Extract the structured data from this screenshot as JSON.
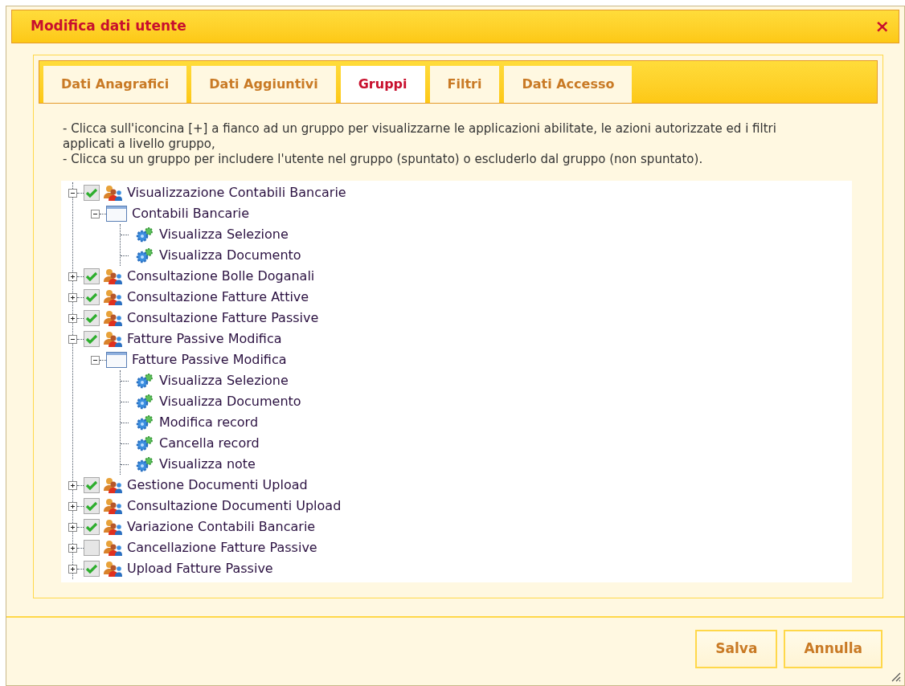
{
  "dialog": {
    "title": "Modifica dati utente",
    "close": "×"
  },
  "tabs": [
    {
      "label": "Dati Anagrafici",
      "selected": false
    },
    {
      "label": "Dati Aggiuntivi",
      "selected": false
    },
    {
      "label": "Gruppi",
      "selected": true
    },
    {
      "label": "Filtri",
      "selected": false
    },
    {
      "label": "Dati Accesso",
      "selected": false
    }
  ],
  "instructions": [
    "- Clicca sull'iconcina [+] a fianco ad un gruppo per visualizzarne le applicazioni abilitate, le azioni autorizzate ed i filtri applicati a livello gruppo,",
    "- Clicca su un gruppo per includere l'utente nel gruppo (spuntato) o escluderlo dal gruppo (non spuntato)."
  ],
  "tree": [
    {
      "kind": "group",
      "label": "Visualizzazione Contabili Bancarie",
      "checked": true,
      "expanded": true,
      "children": [
        {
          "kind": "app",
          "label": "Contabili Bancarie",
          "expanded": true,
          "children": [
            {
              "kind": "action",
              "label": "Visualizza Selezione"
            },
            {
              "kind": "action",
              "label": "Visualizza Documento"
            }
          ]
        }
      ]
    },
    {
      "kind": "group",
      "label": "Consultazione Bolle Doganali",
      "checked": true,
      "expanded": false
    },
    {
      "kind": "group",
      "label": "Consultazione Fatture Attive",
      "checked": true,
      "expanded": false
    },
    {
      "kind": "group",
      "label": "Consultazione Fatture Passive",
      "checked": true,
      "expanded": false
    },
    {
      "kind": "group",
      "label": "Fatture Passive Modifica",
      "checked": true,
      "expanded": true,
      "children": [
        {
          "kind": "app",
          "label": "Fatture Passive Modifica",
          "expanded": true,
          "children": [
            {
              "kind": "action",
              "label": "Visualizza Selezione"
            },
            {
              "kind": "action",
              "label": "Visualizza Documento"
            },
            {
              "kind": "action",
              "label": "Modifica record"
            },
            {
              "kind": "action",
              "label": "Cancella record"
            },
            {
              "kind": "action",
              "label": "Visualizza note"
            }
          ]
        }
      ]
    },
    {
      "kind": "group",
      "label": "Gestione Documenti Upload",
      "checked": true,
      "expanded": false
    },
    {
      "kind": "group",
      "label": "Consultazione Documenti Upload",
      "checked": true,
      "expanded": false
    },
    {
      "kind": "group",
      "label": "Variazione Contabili Bancarie",
      "checked": true,
      "expanded": false
    },
    {
      "kind": "group",
      "label": "Cancellazione Fatture Passive",
      "checked": false,
      "expanded": false
    },
    {
      "kind": "group",
      "label": "Upload Fatture Passive",
      "checked": true,
      "expanded": false
    }
  ],
  "buttons": [
    "Salva",
    "Annulla"
  ]
}
